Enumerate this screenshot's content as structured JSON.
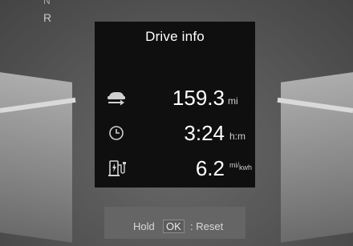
{
  "cluster": {
    "gear_top": "N",
    "gear": "R"
  },
  "panel": {
    "title": "Drive info",
    "rows": [
      {
        "icon": "distance-car-icon",
        "value": "159.3",
        "unit": "mi"
      },
      {
        "icon": "clock-icon",
        "value": "3:24",
        "unit": "h:m"
      },
      {
        "icon": "ev-charge-efficiency-icon",
        "value": "6.2",
        "unit_main": "mi",
        "unit_sub": "kwh"
      }
    ]
  },
  "bottom": {
    "hold": "Hold",
    "ok": "OK",
    "reset": ": Reset"
  }
}
